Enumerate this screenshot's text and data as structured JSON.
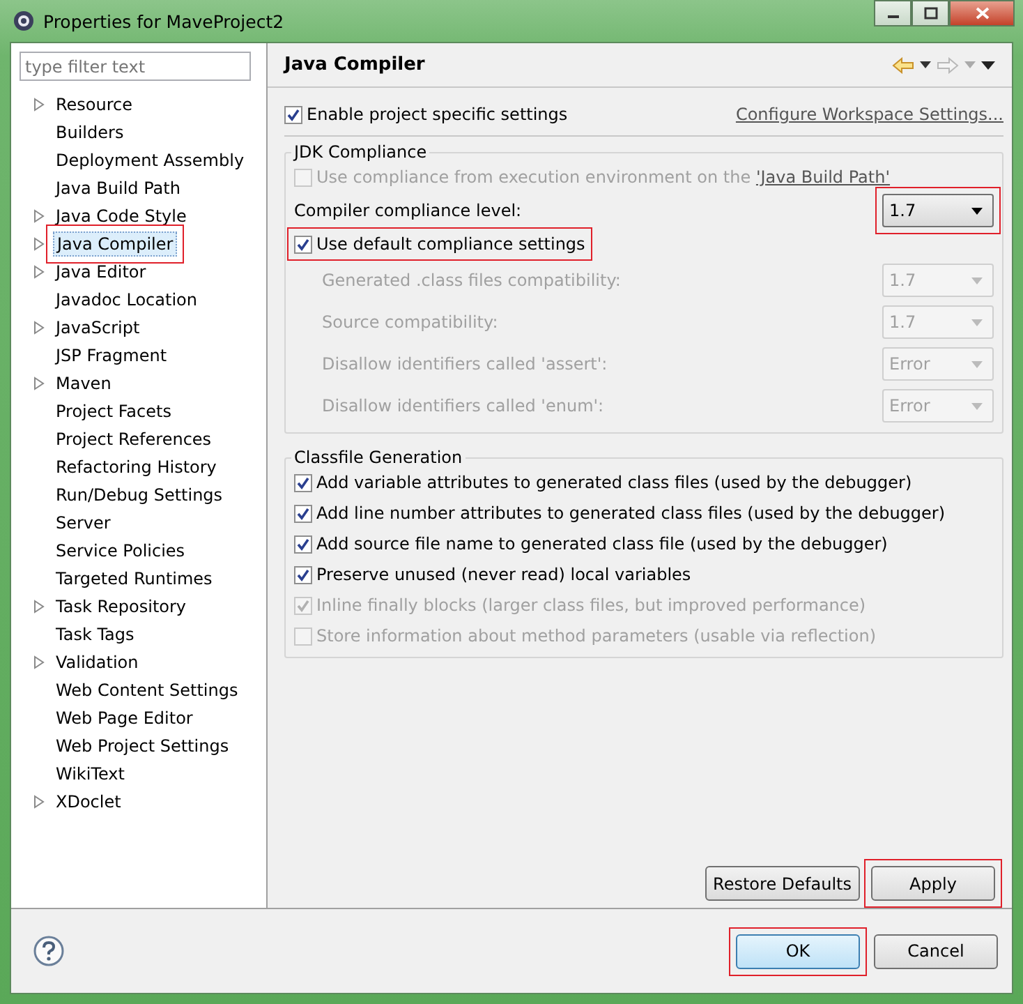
{
  "window": {
    "title": "Properties for MaveProject2"
  },
  "filter": {
    "placeholder": "type filter text"
  },
  "tree": {
    "items": [
      {
        "label": "Resource",
        "expandable": true,
        "selected": false,
        "highlighted": false
      },
      {
        "label": "Builders",
        "expandable": false,
        "selected": false,
        "highlighted": false
      },
      {
        "label": "Deployment Assembly",
        "expandable": false,
        "selected": false,
        "highlighted": false
      },
      {
        "label": "Java Build Path",
        "expandable": false,
        "selected": false,
        "highlighted": false
      },
      {
        "label": "Java Code Style",
        "expandable": true,
        "selected": false,
        "highlighted": false
      },
      {
        "label": "Java Compiler",
        "expandable": true,
        "selected": true,
        "highlighted": true
      },
      {
        "label": "Java Editor",
        "expandable": true,
        "selected": false,
        "highlighted": false
      },
      {
        "label": "Javadoc Location",
        "expandable": false,
        "selected": false,
        "highlighted": false
      },
      {
        "label": "JavaScript",
        "expandable": true,
        "selected": false,
        "highlighted": false
      },
      {
        "label": "JSP Fragment",
        "expandable": false,
        "selected": false,
        "highlighted": false
      },
      {
        "label": "Maven",
        "expandable": true,
        "selected": false,
        "highlighted": false
      },
      {
        "label": "Project Facets",
        "expandable": false,
        "selected": false,
        "highlighted": false
      },
      {
        "label": "Project References",
        "expandable": false,
        "selected": false,
        "highlighted": false
      },
      {
        "label": "Refactoring History",
        "expandable": false,
        "selected": false,
        "highlighted": false
      },
      {
        "label": "Run/Debug Settings",
        "expandable": false,
        "selected": false,
        "highlighted": false
      },
      {
        "label": "Server",
        "expandable": false,
        "selected": false,
        "highlighted": false
      },
      {
        "label": "Service Policies",
        "expandable": false,
        "selected": false,
        "highlighted": false
      },
      {
        "label": "Targeted Runtimes",
        "expandable": false,
        "selected": false,
        "highlighted": false
      },
      {
        "label": "Task Repository",
        "expandable": true,
        "selected": false,
        "highlighted": false
      },
      {
        "label": "Task Tags",
        "expandable": false,
        "selected": false,
        "highlighted": false
      },
      {
        "label": "Validation",
        "expandable": true,
        "selected": false,
        "highlighted": false
      },
      {
        "label": "Web Content Settings",
        "expandable": false,
        "selected": false,
        "highlighted": false
      },
      {
        "label": "Web Page Editor",
        "expandable": false,
        "selected": false,
        "highlighted": false
      },
      {
        "label": "Web Project Settings",
        "expandable": false,
        "selected": false,
        "highlighted": false
      },
      {
        "label": "WikiText",
        "expandable": false,
        "selected": false,
        "highlighted": false
      },
      {
        "label": "XDoclet",
        "expandable": true,
        "selected": false,
        "highlighted": false
      }
    ]
  },
  "page": {
    "title": "Java Compiler",
    "enable": {
      "label": "Enable project specific settings",
      "checked": true
    },
    "workspace_link": "Configure Workspace Settings...",
    "jdk": {
      "title": "JDK Compliance",
      "use_ee": {
        "label": "Use compliance from execution environment on the ",
        "link": "'Java Build Path'",
        "checked": false,
        "disabled": true
      },
      "compliance": {
        "label": "Compiler compliance level:",
        "value": "1.7",
        "highlighted": true
      },
      "use_default": {
        "label": "Use default compliance settings",
        "checked": true,
        "highlighted": true
      },
      "settings": [
        {
          "label": "Generated .class files compatibility:",
          "value": "1.7",
          "disabled": true
        },
        {
          "label": "Source compatibility:",
          "value": "1.7",
          "disabled": true
        },
        {
          "label": "Disallow identifiers called 'assert':",
          "value": "Error",
          "disabled": true
        },
        {
          "label": "Disallow identifiers called 'enum':",
          "value": "Error",
          "disabled": true
        }
      ]
    },
    "classfile": {
      "title": "Classfile Generation",
      "options": [
        {
          "label": "Add variable attributes to generated class files (used by the debugger)",
          "checked": true,
          "disabled": false
        },
        {
          "label": "Add line number attributes to generated class files (used by the debugger)",
          "checked": true,
          "disabled": false
        },
        {
          "label": "Add source file name to generated class file (used by the debugger)",
          "checked": true,
          "disabled": false
        },
        {
          "label": "Preserve unused (never read) local variables",
          "checked": true,
          "disabled": false
        },
        {
          "label": "Inline finally blocks (larger class files, but improved performance)",
          "checked": true,
          "disabled": true
        },
        {
          "label": "Store information about method parameters (usable via reflection)",
          "checked": false,
          "disabled": true
        }
      ]
    },
    "restore": {
      "label": "Restore Defaults",
      "highlighted": false
    },
    "apply": {
      "label": "Apply",
      "highlighted": true
    }
  },
  "dialog_buttons": [
    {
      "label": "OK",
      "default": true,
      "highlighted": true
    },
    {
      "label": "Cancel",
      "default": false,
      "highlighted": false
    }
  ]
}
